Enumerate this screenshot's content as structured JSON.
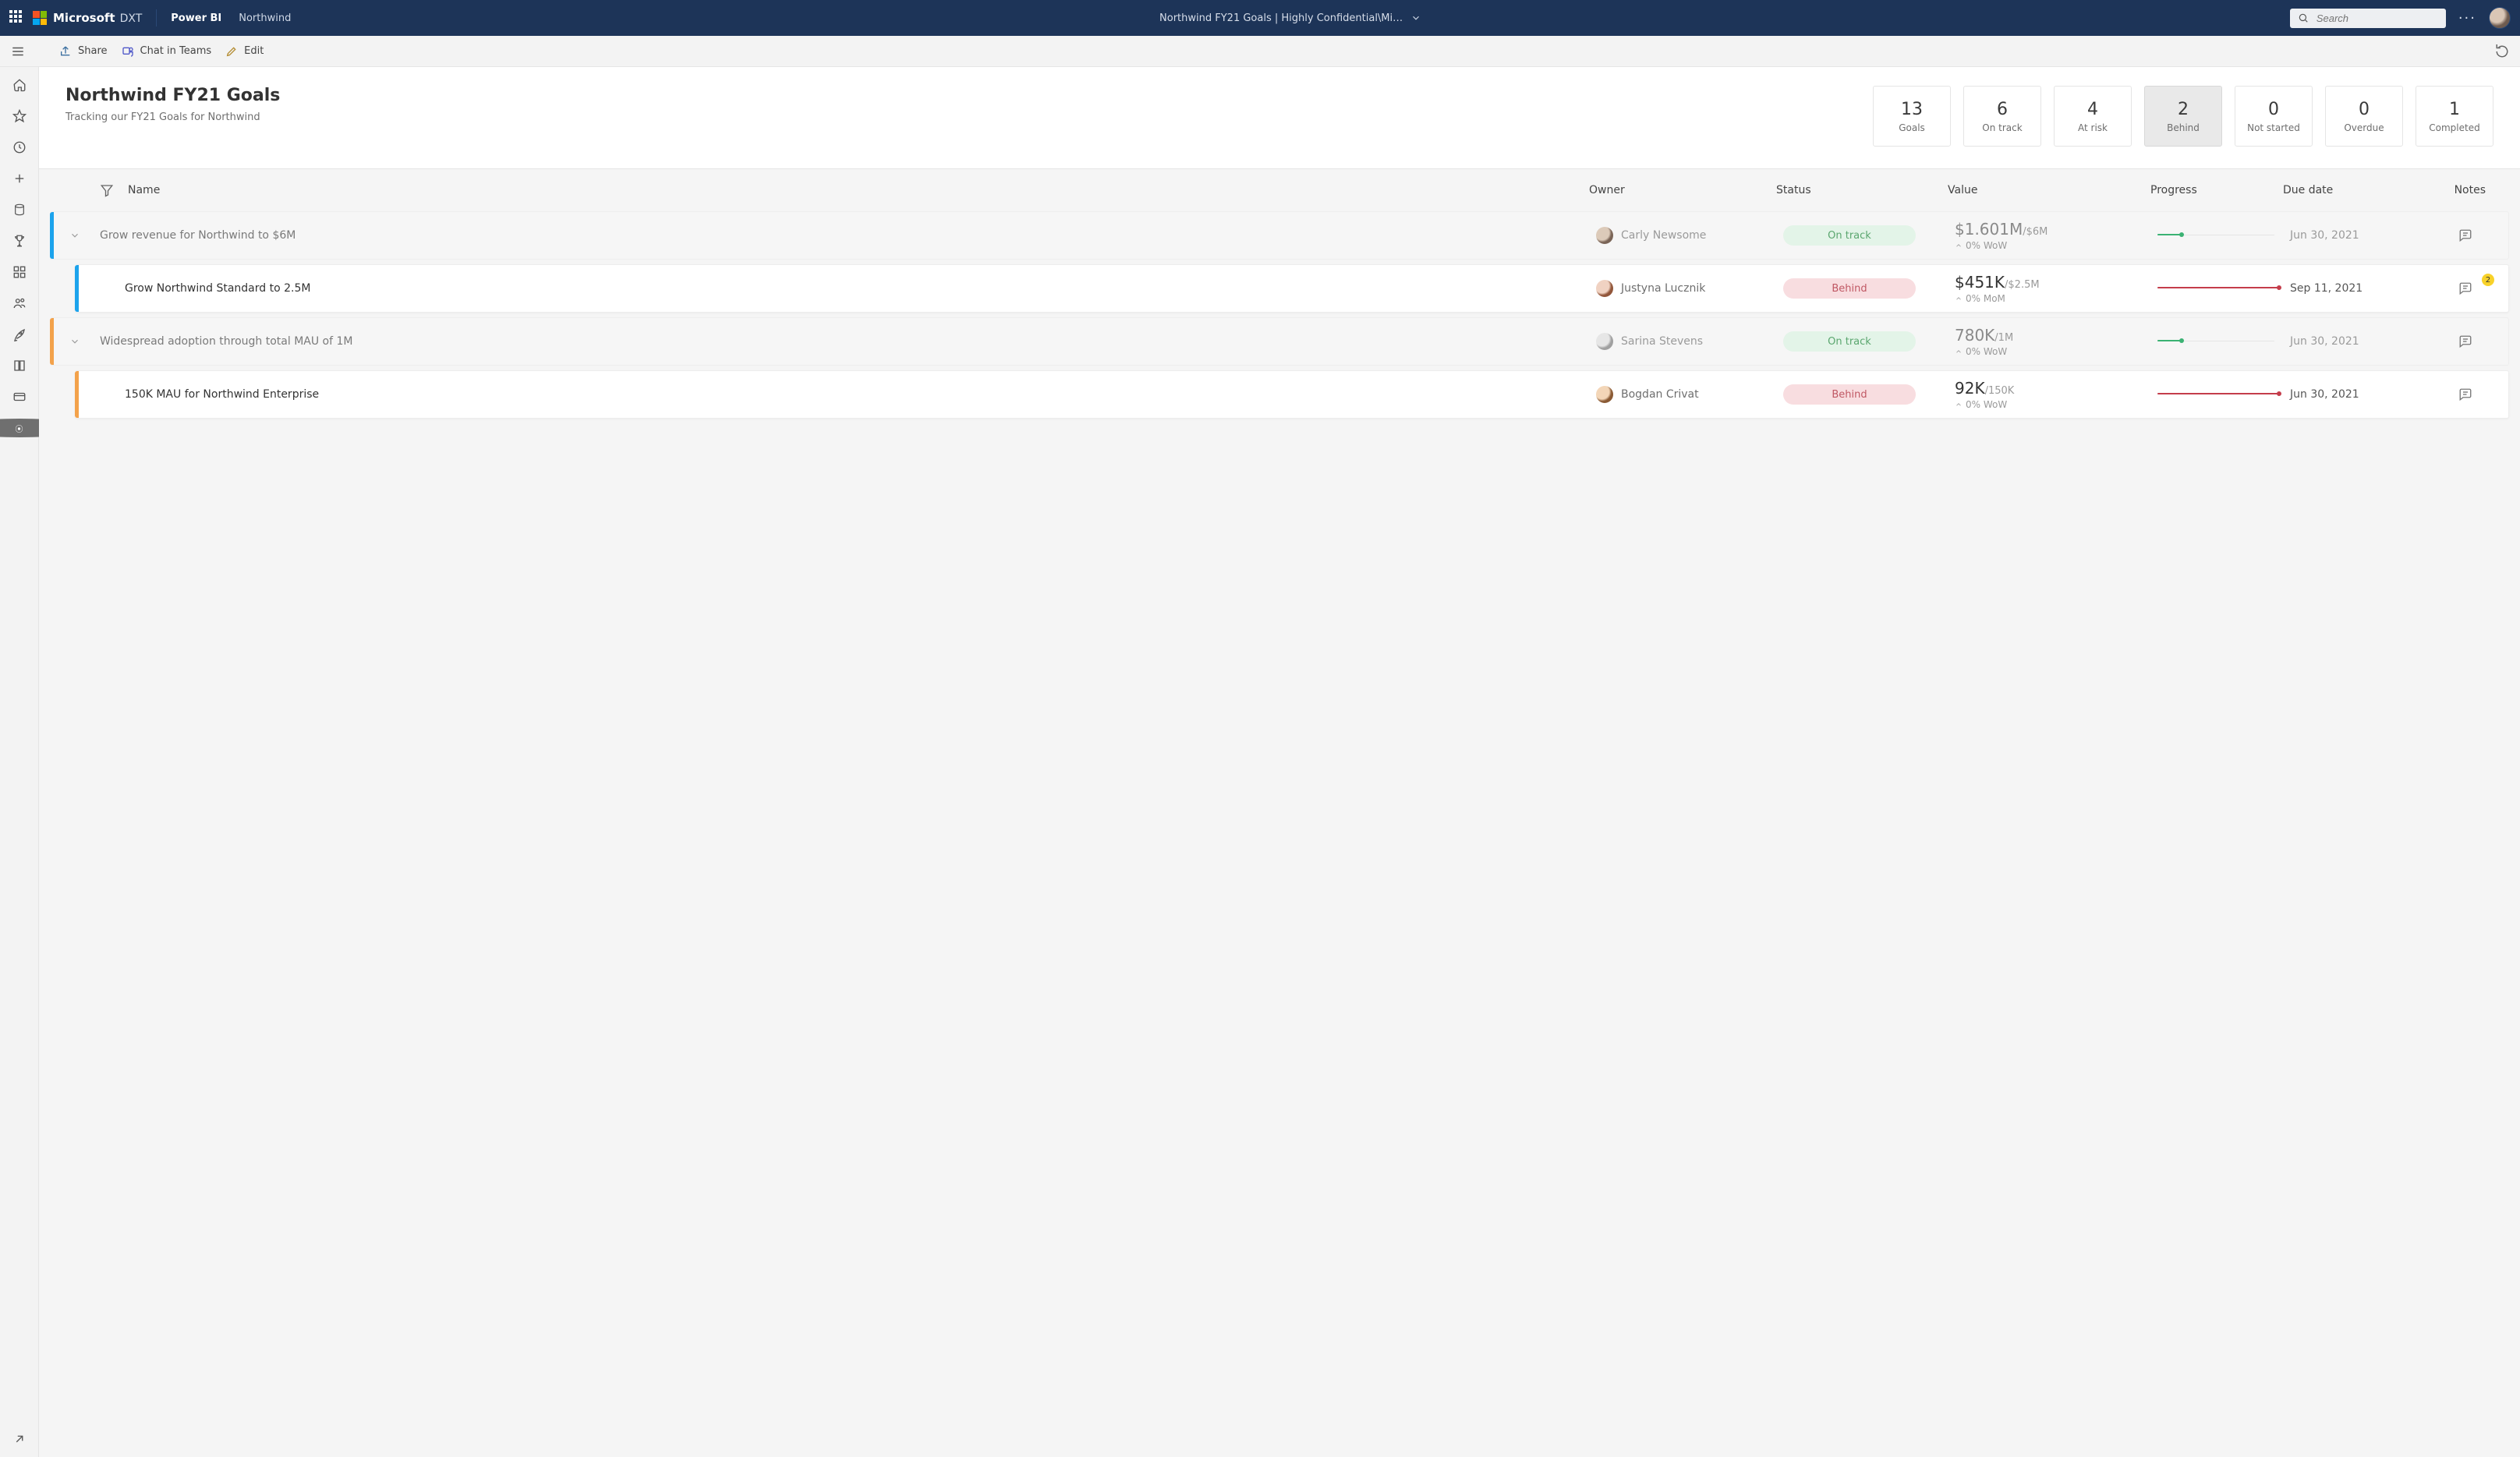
{
  "header": {
    "brand": "Microsoft",
    "dxt": "DXT",
    "app": "Power BI",
    "workspace": "Northwind",
    "center_title": "Northwind FY21 Goals  |  Highly Confidential\\Mi…",
    "search_placeholder": "Search"
  },
  "toolbar": {
    "share": "Share",
    "chat": "Chat in Teams",
    "edit": "Edit"
  },
  "page": {
    "title": "Northwind FY21 Goals",
    "subtitle": "Tracking our FY21 Goals for Northwind"
  },
  "stats": [
    {
      "value": "13",
      "label": "Goals",
      "selected": false
    },
    {
      "value": "6",
      "label": "On track",
      "selected": false
    },
    {
      "value": "4",
      "label": "At risk",
      "selected": false
    },
    {
      "value": "2",
      "label": "Behind",
      "selected": true
    },
    {
      "value": "0",
      "label": "Not started",
      "selected": false
    },
    {
      "value": "0",
      "label": "Overdue",
      "selected": false
    },
    {
      "value": "1",
      "label": "Completed",
      "selected": false
    }
  ],
  "columns": {
    "name": "Name",
    "owner": "Owner",
    "status": "Status",
    "value": "Value",
    "progress": "Progress",
    "due": "Due date",
    "notes": "Notes"
  },
  "rows": [
    {
      "kind": "parent",
      "color": "blue",
      "name": "Grow revenue for Northwind to $6M",
      "owner": "Carly Newsome",
      "avatar": "a",
      "status": "On track",
      "status_color": "green",
      "value": "$1.601M",
      "target": "/$6M",
      "delta": "0% WoW",
      "progress": "green",
      "due": "Jun 30, 2021",
      "notes_badge": ""
    },
    {
      "kind": "child",
      "color": "blue",
      "name": "Grow Northwind Standard to 2.5M",
      "owner": "Justyna Lucznik",
      "avatar": "b",
      "status": "Behind",
      "status_color": "red",
      "value": "$451K",
      "target": "/$2.5M",
      "delta": "0% MoM",
      "progress": "red",
      "due": "Sep 11, 2021",
      "notes_badge": "2"
    },
    {
      "kind": "parent",
      "color": "orange",
      "name": "Widespread adoption through total MAU of 1M",
      "owner": "Sarina Stevens",
      "avatar": "c",
      "status": "On track",
      "status_color": "green",
      "value": "780K",
      "target": "/1M",
      "delta": "0% WoW",
      "progress": "green",
      "due": "Jun 30, 2021",
      "notes_badge": ""
    },
    {
      "kind": "child",
      "color": "orange",
      "name": "150K MAU for Northwind Enterprise",
      "owner": "Bogdan Crivat",
      "avatar": "d",
      "status": "Behind",
      "status_color": "red",
      "value": "92K",
      "target": "/150K",
      "delta": "0% WoW",
      "progress": "red",
      "due": "Jun 30, 2021",
      "notes_badge": ""
    }
  ],
  "colors": {
    "blue": "#1CA3EC",
    "orange": "#F3A24B"
  }
}
